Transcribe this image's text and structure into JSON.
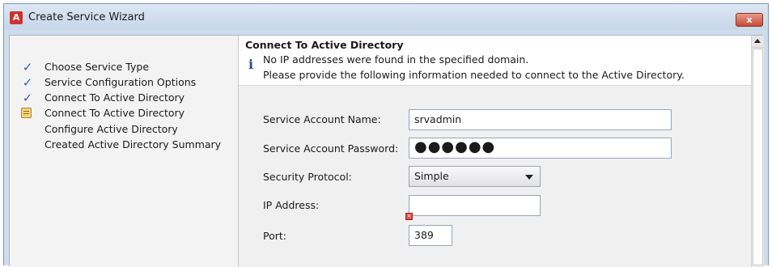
{
  "window": {
    "title": "Create Service Wizard",
    "app_icon_glyph": "A",
    "close_glyph": "x"
  },
  "steps": [
    {
      "label": "Choose Service Type",
      "state": "done",
      "icon": "checkmark-icon"
    },
    {
      "label": "Service Configuration Options",
      "state": "done",
      "icon": "checkmark-icon"
    },
    {
      "label": "Connect To Active Directory",
      "state": "done",
      "icon": "checkmark-icon"
    },
    {
      "label": "Connect To Active Directory",
      "state": "current",
      "icon": "current-step-icon"
    },
    {
      "label": "Configure Active Directory",
      "state": "pending",
      "icon": ""
    },
    {
      "label": "Created Active Directory Summary",
      "state": "pending",
      "icon": ""
    }
  ],
  "banner": {
    "title": "Connect To Active Directory",
    "info_glyph": "i",
    "message_line1": "No IP addresses were found in the specified domain.",
    "message_line2": "Please provide the following information needed to connect to the Active Directory."
  },
  "form": {
    "account_name": {
      "label": "Service Account Name:",
      "value": "srvadmin"
    },
    "account_password": {
      "label": "Service Account Password:",
      "value": "●●●●●●"
    },
    "security_protocol": {
      "label": "Security Protocol:",
      "value": "Simple"
    },
    "ip_address": {
      "label": "IP Address:",
      "value": "",
      "error_glyph": "×"
    },
    "port": {
      "label": "Port:",
      "value": "389"
    }
  },
  "checkmark_glyph": "✓",
  "colors": {
    "check": "#2c64b7",
    "close_button": "#c74a35",
    "error": "#e24b4b"
  }
}
